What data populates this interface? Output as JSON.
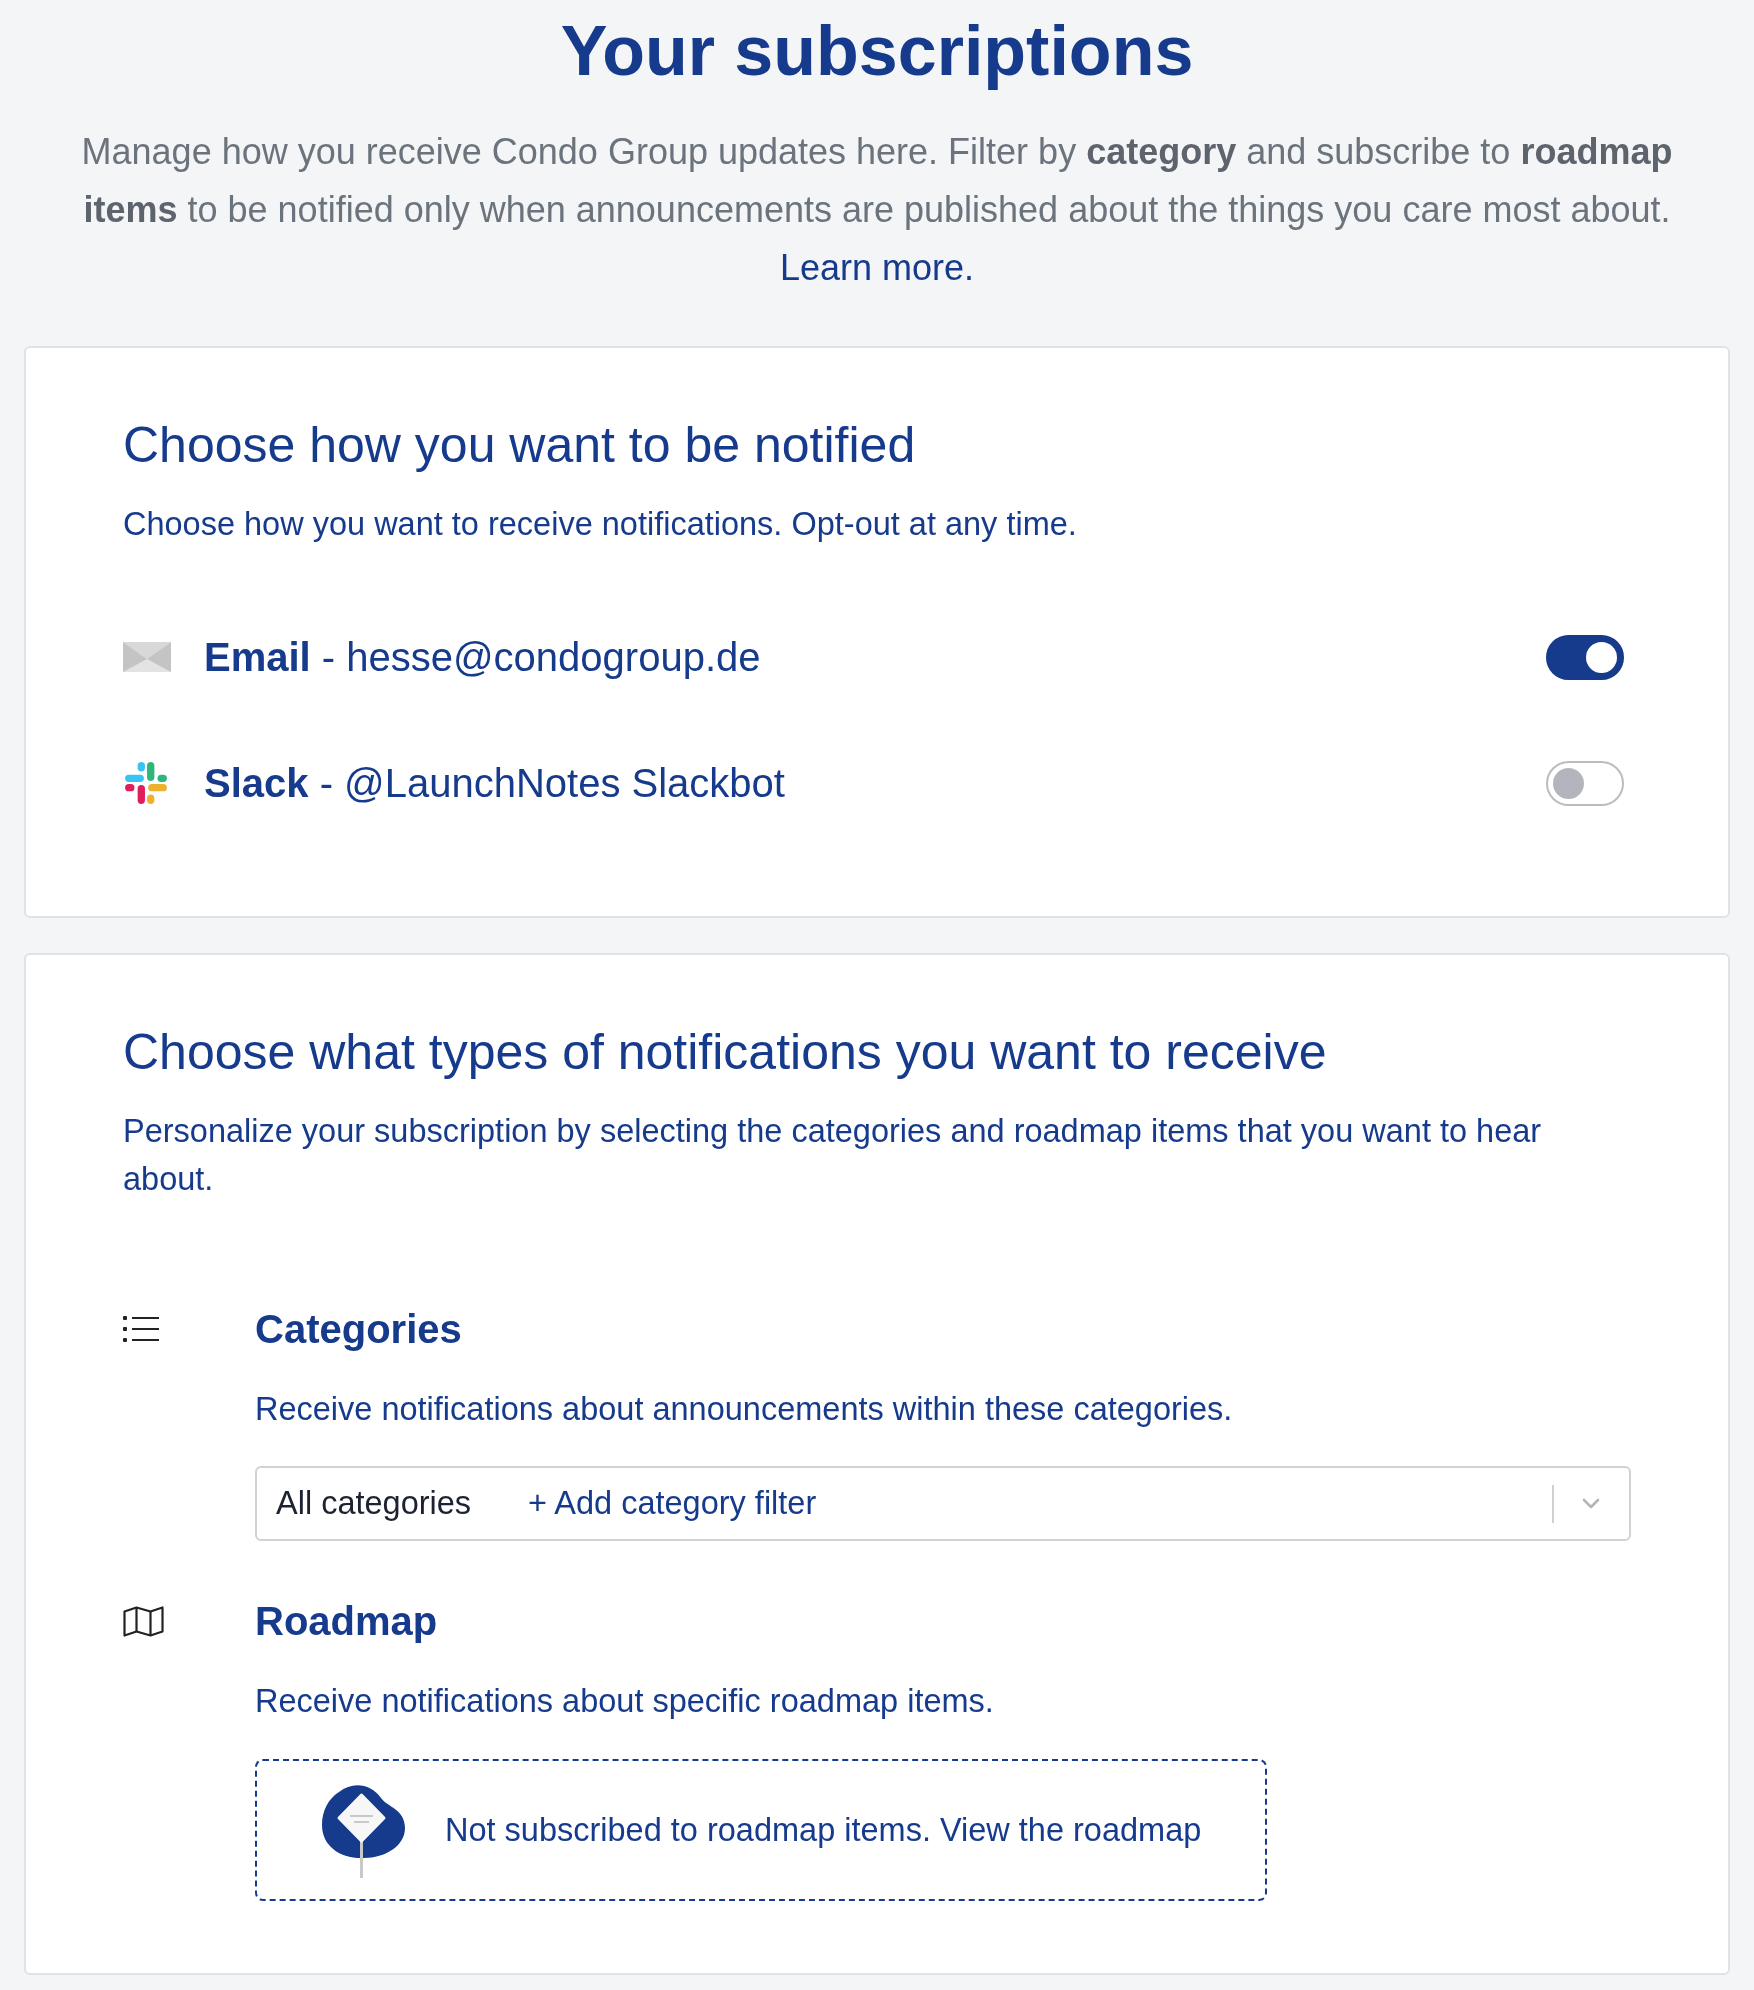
{
  "header": {
    "title": "Your subscriptions",
    "intro": "Manage how you receive Condo Group updates here. Filter by **category** and subscribe to **roadmap items** to be notified only when announcements are published about the things you care most about.",
    "link": "Learn more."
  },
  "notification_channels": {
    "heading": "Choose how you want to be notified",
    "description": "Choose how you want to receive notifications. Opt-out at any time.",
    "channels": [
      {
        "kind": "email",
        "label": "**Email** - hesse@condogroup.de",
        "on": true
      },
      {
        "kind": "slack",
        "label": "**Slack** - @LaunchNotes Slackbot",
        "on": false
      }
    ]
  },
  "notification_types": {
    "heading": "Choose what types of notifications you want to receive",
    "description": "Personalize your subscription by selecting the categories and roadmap items that you want to hear about.",
    "sections": [
      {
        "kind": "categories",
        "title": "Categories",
        "description": "Receive notifications about announcements within these categories.",
        "filter": {
          "value": "All categories",
          "add_label": "+ Add category filter"
        }
      },
      {
        "kind": "roadmap",
        "title": "Roadmap",
        "description": "Receive notifications about specific roadmap items.",
        "empty_state": "Not subscribed to roadmap items. View the roadmap"
      }
    ]
  }
}
